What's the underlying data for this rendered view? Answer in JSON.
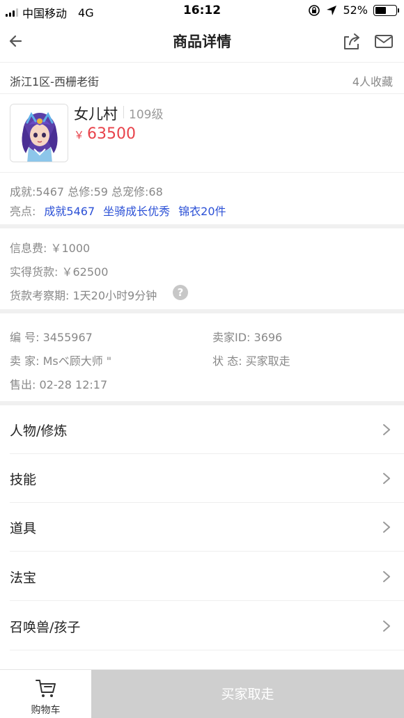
{
  "status_bar": {
    "carrier": "中国移动",
    "network": "4G",
    "time": "16:12",
    "battery": "52%"
  },
  "nav": {
    "title": "商品详情",
    "back_icon": "arrow-left-icon",
    "share_icon": "share-icon",
    "mail_icon": "mail-icon"
  },
  "server": {
    "name": "浙江1区-西栅老街",
    "favorites": "4人收藏"
  },
  "character": {
    "school": "女儿村",
    "level": "109级",
    "price_symbol": "￥",
    "price": "63500"
  },
  "stats": {
    "summary": "成就:5467 总修:59 总宠修:68",
    "highlights_label": "亮点:",
    "highlights": [
      "成就5467",
      "坐骑成长优秀",
      "锦衣20件"
    ]
  },
  "fees": {
    "info_fee": "信息费: ￥1000",
    "received": "实得货款: ￥62500",
    "review_period": "货款考察期: 1天20小时9分钟",
    "help_glyph": "?"
  },
  "order": {
    "number": "编  号: 3455967",
    "seller_id": "卖家ID: 3696",
    "seller": "卖  家: Msベ顾大师 \"",
    "status": "状  态: 买家取走",
    "sold": "售出: 02-28 12:17"
  },
  "menu": [
    "人物/修炼",
    "技能",
    "道具",
    "法宝",
    "召唤兽/孩子"
  ],
  "bottom": {
    "cart_label": "购物车",
    "buy_label": "买家取走"
  },
  "colors": {
    "price": "#e8434b",
    "highlight": "#2b50d6",
    "disabled_button": "#cfcfcf"
  }
}
